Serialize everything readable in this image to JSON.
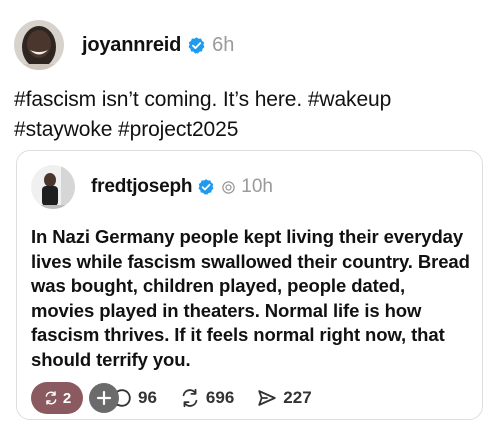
{
  "post": {
    "author": "joyannreid",
    "time": "6h",
    "text": "#fascism isn’t coming. It’s here. #wakeup\n#staywoke #project2025"
  },
  "quote": {
    "author": "fredtjoseph",
    "time": "10h",
    "text": "In Nazi Germany people kept living their everyday lives while fascism swallowed their country. Bread was bought, children played, people dated, movies played in theaters. Normal life is how fascism thrives. If it feels normal right now, that should terrify you."
  },
  "actions": {
    "repost_badge_count": "2",
    "reply_count": "96",
    "repost_count": "696",
    "share_count": "227"
  },
  "icons": {
    "verified": "verified-badge-icon",
    "threads_marker": "threads-icon",
    "reply": "reply-icon",
    "repost": "repost-icon",
    "share": "share-icon",
    "plus": "plus-icon"
  },
  "colors": {
    "verified_blue": "#1d9bf0",
    "muted_gray": "#9a9a9a",
    "pill_bg": "#8a5a60",
    "plus_bg": "#6b6b6b"
  }
}
